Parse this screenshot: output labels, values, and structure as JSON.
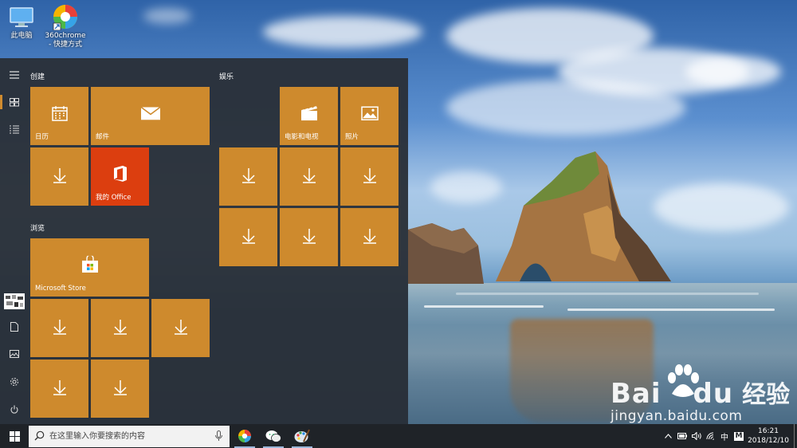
{
  "desktop": {
    "icons": [
      {
        "label": "此电脑",
        "icon": "this-pc-icon"
      },
      {
        "label": "360chrome",
        "sublabel": "- 快捷方式",
        "icon": "360chrome-icon"
      }
    ],
    "watermark": {
      "logo_text": "Bai",
      "logo_text2": "du",
      "cn_text": "经验",
      "url": "jingyan.baidu.com"
    }
  },
  "start_menu": {
    "rail": [
      {
        "icon": "hamburger-icon"
      },
      {
        "icon": "tiles-icon"
      },
      {
        "icon": "all-apps-list-icon"
      },
      {
        "icon": "user-avatar-icon"
      },
      {
        "icon": "documents-icon"
      },
      {
        "icon": "pictures-icon"
      },
      {
        "icon": "settings-gear-icon"
      },
      {
        "icon": "power-icon"
      }
    ],
    "groups": {
      "create": "创建",
      "browse": "浏览",
      "entertainment": "娱乐"
    },
    "tiles": {
      "calendar": "日历",
      "mail": "邮件",
      "office": "我的 Office",
      "store": "Microsoft Store",
      "movies": "电影和电视",
      "photos": "照片"
    }
  },
  "taskbar": {
    "search_placeholder": "在这里输入你要搜索的内容",
    "apps": [
      {
        "icon": "360chrome-icon"
      },
      {
        "icon": "wechat-icon"
      },
      {
        "icon": "paint-icon"
      }
    ],
    "tray": {
      "chevron": "^",
      "ime": "中",
      "ime_mode": "M"
    },
    "clock": {
      "time": "16:21",
      "date": "2018/12/10"
    }
  },
  "colors": {
    "tile": "#ce8a2d",
    "office_tile": "#dc3e0f",
    "menu_bg": "#2a3038",
    "taskbar_bg": "#1f2328"
  }
}
